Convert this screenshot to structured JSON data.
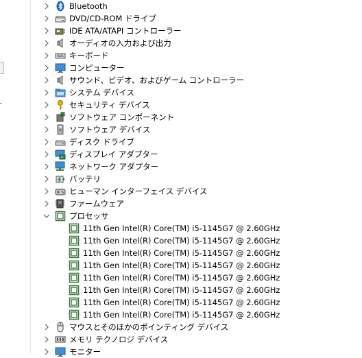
{
  "categories_top": [
    {
      "label": "Bluetooth",
      "icon": "bluetooth-icon"
    },
    {
      "label": "DVD/CD-ROM ドライブ",
      "icon": "dvd-drive-icon"
    },
    {
      "label": "IDE ATA/ATAPI コントローラー",
      "icon": "ide-controller-icon"
    },
    {
      "label": "オーディオの入力および出力",
      "icon": "speaker-icon"
    },
    {
      "label": "キーボード",
      "icon": "keyboard-icon"
    },
    {
      "label": "コンピューター",
      "icon": "monitor-icon"
    },
    {
      "label": "サウンド、ビデオ、およびゲーム コントローラー",
      "icon": "speaker-icon"
    },
    {
      "label": "システム デバイス",
      "icon": "folder-icon"
    },
    {
      "label": "セキュリティ デバイス",
      "icon": "key-icon"
    },
    {
      "label": "ソフトウェア コンポーネント",
      "icon": "puzzle-icon"
    },
    {
      "label": "ソフトウェア デバイス",
      "icon": "device-icon"
    },
    {
      "label": "ディスク ドライブ",
      "icon": "disk-drive-icon"
    },
    {
      "label": "ディスプレイ アダプター",
      "icon": "display-adapter-icon"
    },
    {
      "label": "ネットワーク アダプター",
      "icon": "network-icon"
    },
    {
      "label": "バッテリ",
      "icon": "battery-icon"
    },
    {
      "label": "ヒューマン インターフェイス デバイス",
      "icon": "hid-icon"
    },
    {
      "label": "ファームウェア",
      "icon": "firmware-icon"
    },
    {
      "label": "プロセッサ",
      "icon": "processor-icon",
      "expanded": true
    }
  ],
  "processors": [
    {
      "label": "11th Gen Intel(R) Core(TM) i5-1145G7 @ 2.60GHz"
    },
    {
      "label": "11th Gen Intel(R) Core(TM) i5-1145G7 @ 2.60GHz"
    },
    {
      "label": "11th Gen Intel(R) Core(TM) i5-1145G7 @ 2.60GHz"
    },
    {
      "label": "11th Gen Intel(R) Core(TM) i5-1145G7 @ 2.60GHz"
    },
    {
      "label": "11th Gen Intel(R) Core(TM) i5-1145G7 @ 2.60GHz"
    },
    {
      "label": "11th Gen Intel(R) Core(TM) i5-1145G7 @ 2.60GHz"
    },
    {
      "label": "11th Gen Intel(R) Core(TM) i5-1145G7 @ 2.60GHz"
    },
    {
      "label": "11th Gen Intel(R) Core(TM) i5-1145G7 @ 2.60GHz"
    }
  ],
  "categories_bottom": [
    {
      "label": "マウスとそのほかのポインティング デバイス",
      "icon": "mouse-icon"
    },
    {
      "label": "メモリ テクノロジ デバイス",
      "icon": "memory-icon"
    },
    {
      "label": "モニター",
      "icon": "monitor-icon"
    }
  ],
  "colors": {
    "chevron": "#606060",
    "processor_green": "#3f7a3f"
  }
}
